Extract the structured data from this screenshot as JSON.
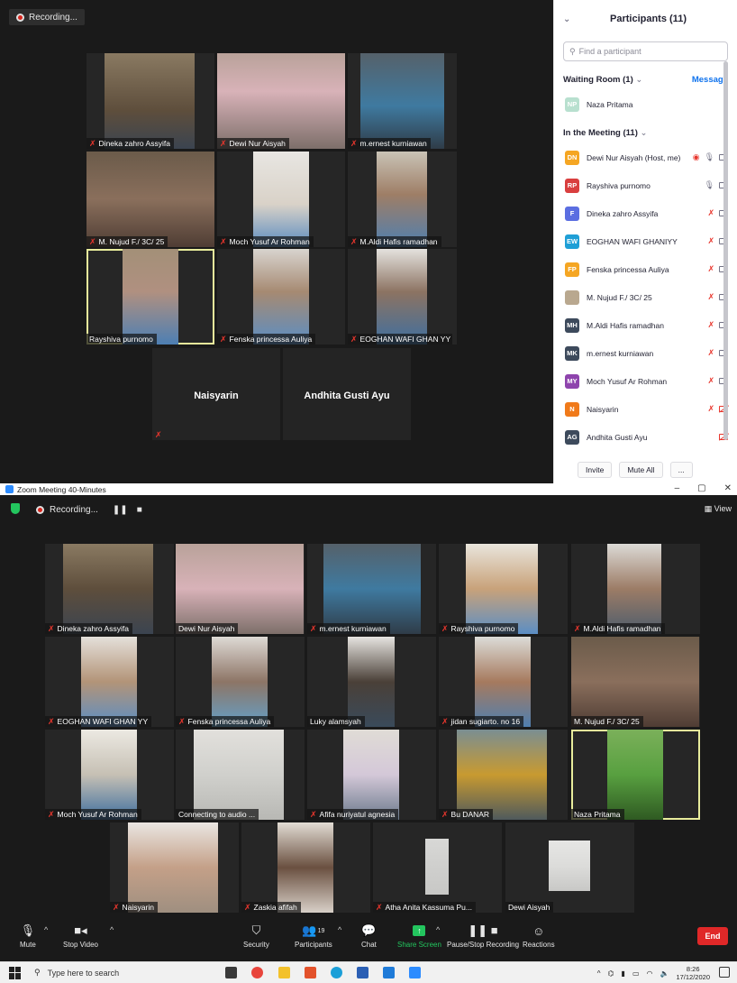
{
  "top_meeting": {
    "recording_label": "Recording...",
    "tiles": [
      {
        "name": "Dineka zahro Assyifa",
        "muted": true
      },
      {
        "name": "Dewi Nur Aisyah",
        "muted": true
      },
      {
        "name": "m.ernest kurniawan",
        "muted": true
      },
      {
        "name": "M. Nujud F./ 3C/ 25",
        "muted": true
      },
      {
        "name": "Moch Yusuf Ar Rohman",
        "muted": true
      },
      {
        "name": "M.Aldi Hafis ramadhan",
        "muted": true
      },
      {
        "name": "Rayshiva purnomo",
        "muted": false
      },
      {
        "name": "Fenska princessa Auliya",
        "muted": true
      },
      {
        "name": "EOGHAN WAFI GHAN YY",
        "muted": true
      },
      {
        "name": "Naisyarin",
        "muted": true
      },
      {
        "name": "Andhita Gusti Ayu",
        "muted": false
      }
    ]
  },
  "participants_panel": {
    "title": "Participants (11)",
    "search_placeholder": "Find a participant",
    "waiting_room_label": "Waiting Room (1)",
    "message_label": "Message",
    "waiting": [
      {
        "initials": "NP",
        "name": "Naza Pritama",
        "color": "#b8e0cf"
      }
    ],
    "in_meeting_label": "In the Meeting (11)",
    "members": [
      {
        "initials": "DN",
        "name": "Dewi Nur Aisyah (Host, me)",
        "color": "#f5a623",
        "mic": "on",
        "video": "on"
      },
      {
        "initials": "RP",
        "name": "Rayshiva purnomo",
        "color": "#d93f3f",
        "mic": "on",
        "video": "on"
      },
      {
        "initials": "F",
        "name": "Dineka zahro Assyifa",
        "color": "#5b6ee1",
        "mic": "off",
        "video": "on"
      },
      {
        "initials": "EW",
        "name": "EOGHAN WAFI GHANIYY",
        "color": "#1f9fd6",
        "mic": "off",
        "video": "on"
      },
      {
        "initials": "FP",
        "name": "Fenska princessa Auliya",
        "color": "#f5a623",
        "mic": "off",
        "video": "on"
      },
      {
        "initials": "",
        "name": "M. Nujud F./ 3C/ 25",
        "color": "#b9a88f",
        "mic": "off",
        "video": "on"
      },
      {
        "initials": "MH",
        "name": "M.Aldi Hafis ramadhan",
        "color": "#3d4a5c",
        "mic": "off",
        "video": "on"
      },
      {
        "initials": "MK",
        "name": "m.ernest kurniawan",
        "color": "#3d4a5c",
        "mic": "off",
        "video": "on"
      },
      {
        "initials": "MY",
        "name": "Moch Yusuf Ar Rohman",
        "color": "#8e44ad",
        "mic": "off",
        "video": "on"
      },
      {
        "initials": "N",
        "name": "Naisyarin",
        "color": "#f07a1a",
        "mic": "off",
        "video": "off"
      },
      {
        "initials": "AG",
        "name": "Andhita Gusti Ayu",
        "color": "#3d4a5c",
        "mic": "none",
        "video": "off"
      }
    ],
    "invite_label": "Invite",
    "mute_all_label": "Mute All",
    "more_label": "..."
  },
  "bottom_meeting": {
    "window_title": "Zoom Meeting 40-Minutes",
    "recording_label": "Recording...",
    "view_label": "View",
    "tiles": [
      {
        "name": "Dineka zahro Assyifa",
        "muted": true
      },
      {
        "name": "Dewi Nur Aisyah",
        "muted": false
      },
      {
        "name": "m.ernest kurniawan",
        "muted": true
      },
      {
        "name": "Rayshiva purnomo",
        "muted": true
      },
      {
        "name": "M.Aldi Hafis ramadhan",
        "muted": true
      },
      {
        "name": "EOGHAN WAFI GHAN YY",
        "muted": true
      },
      {
        "name": "Fenska princessa Auliya",
        "muted": true
      },
      {
        "name": "Luky alamsyah",
        "muted": false
      },
      {
        "name": "jidan sugiarto. no 16",
        "muted": true
      },
      {
        "name": "M. Nujud F./ 3C/ 25",
        "muted": false
      },
      {
        "name": "Moch Yusuf Ar Rohman",
        "muted": true
      },
      {
        "name": "Connecting to audio ...",
        "muted": false
      },
      {
        "name": "Afifa nuriyatul agnesia",
        "muted": true
      },
      {
        "name": "Bu DANAR",
        "muted": true
      },
      {
        "name": "Naza Pritama",
        "muted": false
      },
      {
        "name": "Naisyarin",
        "muted": true
      },
      {
        "name": "Zaskia afifah",
        "muted": true
      },
      {
        "name": "Atha Anita Kassuma Pu...",
        "muted": true
      },
      {
        "name": "Dewi Aisyah",
        "muted": false
      }
    ],
    "toolbar": {
      "mute": "Mute",
      "stop_video": "Stop Video",
      "security": "Security",
      "participants": "Participants",
      "participants_count": "19",
      "chat": "Chat",
      "share_screen": "Share Screen",
      "recording": "Pause/Stop Recording",
      "reactions": "Reactions",
      "end": "End"
    }
  },
  "taskbar": {
    "search_placeholder": "Type here to search",
    "time": "8:26",
    "date": "17/12/2020"
  }
}
